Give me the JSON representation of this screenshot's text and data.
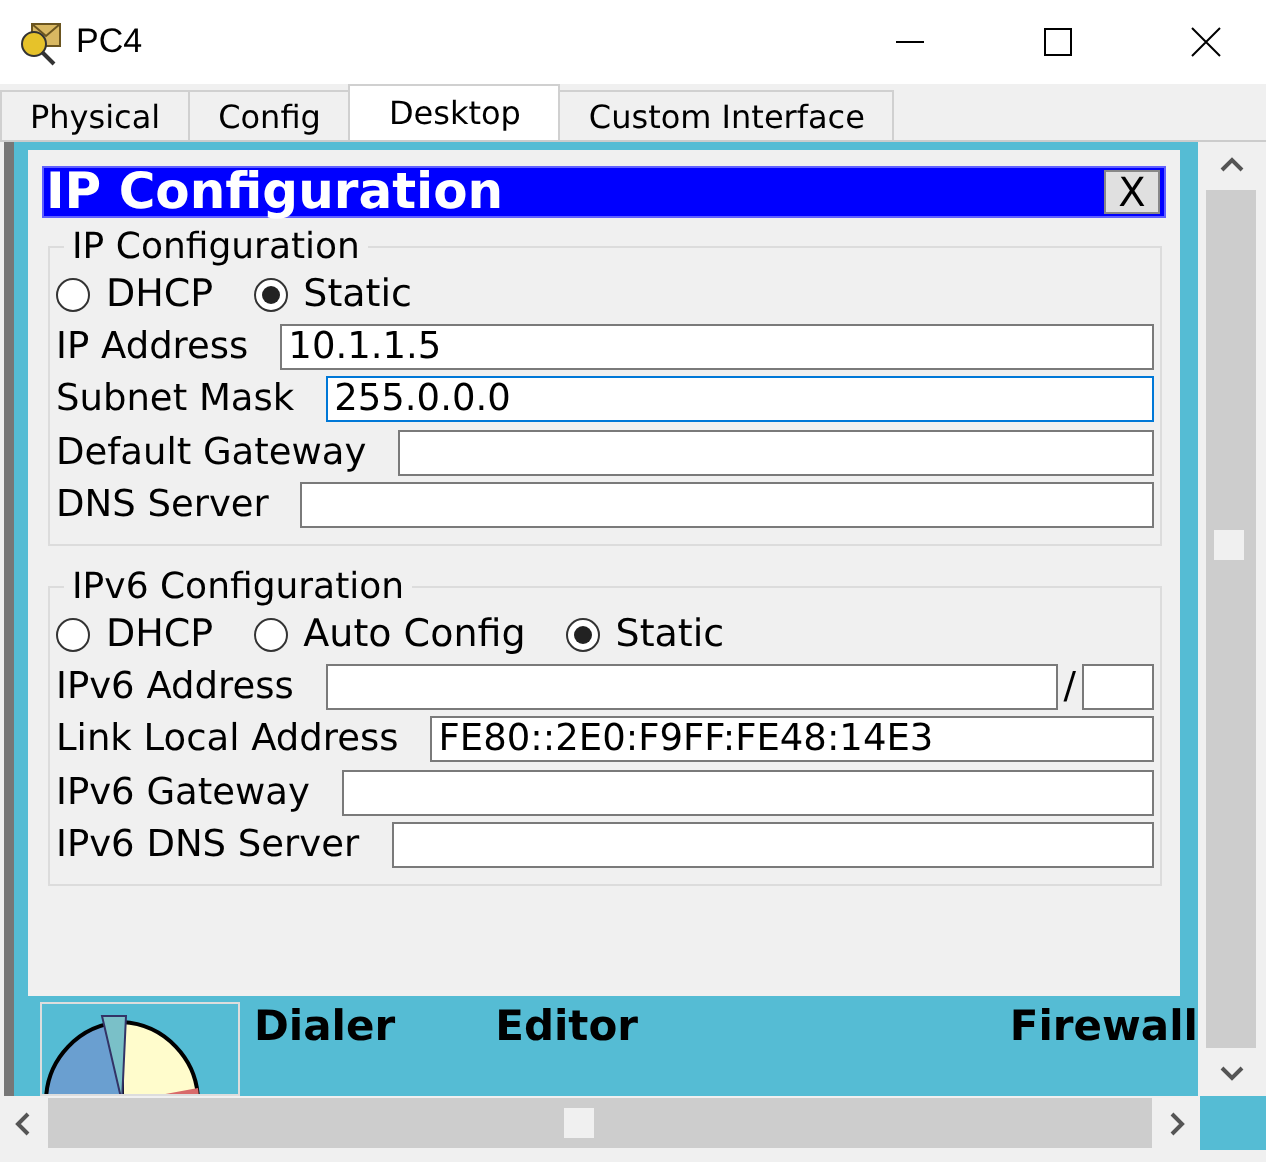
{
  "window": {
    "title": "PC4"
  },
  "tabs": [
    {
      "label": "Physical",
      "selected": false
    },
    {
      "label": "Config",
      "selected": false
    },
    {
      "label": "Desktop",
      "selected": true
    },
    {
      "label": "Custom Interface",
      "selected": false
    }
  ],
  "dialog": {
    "title": "IP Configuration",
    "close": "X",
    "groups": [
      {
        "legend": "IP Configuration",
        "modes": [
          {
            "label": "DHCP",
            "selected": false
          },
          {
            "label": "Static",
            "selected": true
          }
        ],
        "fields": [
          {
            "label": "IP Address",
            "value": "10.1.1.5",
            "focused": false,
            "kind": "text"
          },
          {
            "label": "Subnet Mask",
            "value": "255.0.0.0",
            "focused": true,
            "kind": "text"
          },
          {
            "label": "Default Gateway",
            "focused": false,
            "kind": "text"
          },
          {
            "label": "DNS Server",
            "focused": false,
            "kind": "text"
          }
        ]
      },
      {
        "legend": "IPv6 Configuration",
        "modes": [
          {
            "label": "DHCP",
            "selected": false
          },
          {
            "label": "Auto Config",
            "selected": false
          },
          {
            "label": "Static",
            "selected": true
          }
        ],
        "fields": [
          {
            "label": "IPv6 Address",
            "focused": false,
            "kind": "prefix",
            "separator": "/"
          },
          {
            "label": "Link Local Address",
            "value": "FE80::2E0:F9FF:FE48:14E3",
            "focused": false,
            "kind": "text"
          },
          {
            "label": "IPv6 Gateway",
            "focused": false,
            "kind": "text"
          },
          {
            "label": "IPv6 DNS Server",
            "focused": false,
            "kind": "text"
          }
        ]
      }
    ]
  },
  "desktop_apps": [
    {
      "label": "Dialer"
    },
    {
      "label": "Editor"
    },
    {
      "label": "Firewall"
    }
  ]
}
